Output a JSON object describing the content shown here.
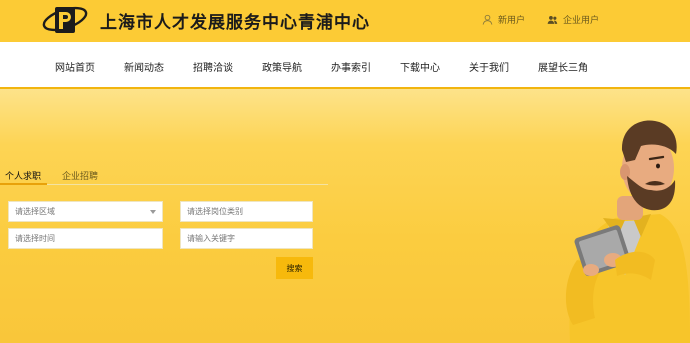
{
  "header": {
    "site_title": "上海市人才发展服务中心青浦中心",
    "new_user": "新用户",
    "enterprise_user": "企业用户"
  },
  "nav": {
    "items": [
      "网站首页",
      "新闻动态",
      "招聘洽谈",
      "政策导航",
      "办事索引",
      "下载中心",
      "关于我们",
      "展望长三角"
    ]
  },
  "search_panel": {
    "tabs": [
      "个人求职",
      "企业招聘"
    ],
    "region_select": "请选择区域",
    "job_category_placeholder": "请选择岗位类别",
    "time_placeholder": "请选择时间",
    "keyword_placeholder": "请输入关键字",
    "search_button": "搜索"
  },
  "colors": {
    "brand_yellow": "#fccb35",
    "accent_orange": "#f7b90c",
    "nav_underline": "#f2b50f"
  }
}
